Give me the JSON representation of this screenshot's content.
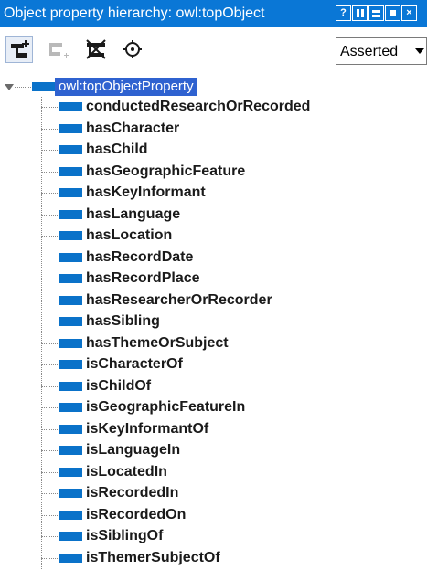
{
  "window": {
    "title": "Object property hierarchy: owl:topObject",
    "buttons": [
      {
        "name": "help-button",
        "glyph": "?"
      },
      {
        "name": "split-vertical-button"
      },
      {
        "name": "split-horizontal-button"
      },
      {
        "name": "maximize-button"
      },
      {
        "name": "close-button",
        "glyph": "×"
      }
    ]
  },
  "toolbar": {
    "tools": [
      {
        "name": "add-sub-property-icon",
        "active": true
      },
      {
        "name": "add-sibling-property-icon",
        "active": false
      },
      {
        "name": "delete-property-icon",
        "active": true
      },
      {
        "name": "find-usage-icon",
        "active": true
      }
    ],
    "view_mode": {
      "selected": "Asserted"
    }
  },
  "tree": {
    "root": {
      "label": "owl:topObjectProperty",
      "expanded": true,
      "selected": true
    },
    "children": [
      {
        "label": "conductedResearchOrRecorded"
      },
      {
        "label": "hasCharacter"
      },
      {
        "label": "hasChild"
      },
      {
        "label": "hasGeographicFeature"
      },
      {
        "label": "hasKeyInformant"
      },
      {
        "label": "hasLanguage"
      },
      {
        "label": "hasLocation"
      },
      {
        "label": "hasRecordDate"
      },
      {
        "label": "hasRecordPlace"
      },
      {
        "label": "hasResearcherOrRecorder"
      },
      {
        "label": "hasSibling"
      },
      {
        "label": "hasThemeOrSubject"
      },
      {
        "label": "isCharacterOf"
      },
      {
        "label": "isChildOf"
      },
      {
        "label": "isGeographicFeatureIn"
      },
      {
        "label": "isKeyInformantOf"
      },
      {
        "label": "isLanguageIn"
      },
      {
        "label": "isLocatedIn"
      },
      {
        "label": "isRecordedIn"
      },
      {
        "label": "isRecordedOn"
      },
      {
        "label": "isSiblingOf"
      },
      {
        "label": "isThemerSubjectOf"
      }
    ]
  },
  "colors": {
    "title_bar": "#0a77d6",
    "selection": "#2f62d0",
    "property_icon": "#0a72c9"
  }
}
